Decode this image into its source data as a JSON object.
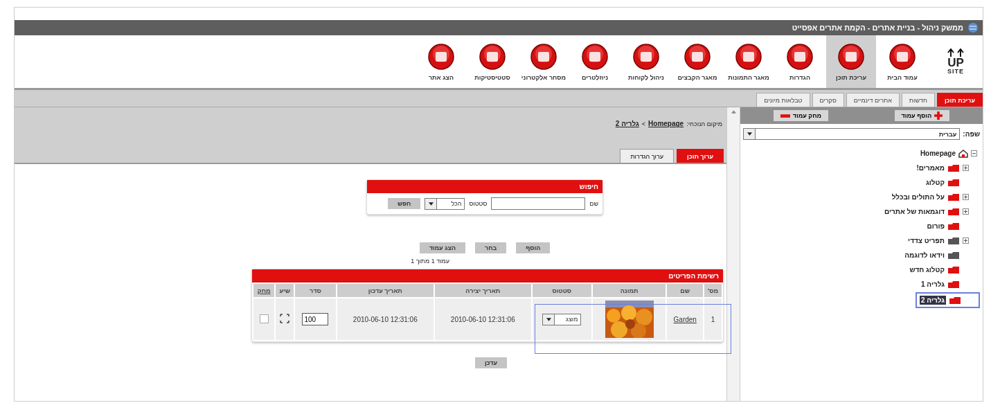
{
  "window": {
    "title": "ממשק ניהול - בניית אתרים - הקמת אתרים אפסייט"
  },
  "logo": {
    "top": "UP",
    "bottom": "SITE"
  },
  "toolbar": [
    {
      "label": "עמוד הבית",
      "selected": false
    },
    {
      "label": "עריכת תוכן",
      "selected": true
    },
    {
      "label": "הגדרות",
      "selected": false
    },
    {
      "label": "מאגר התמונות",
      "selected": false
    },
    {
      "label": "מאגר הקבצים",
      "selected": false
    },
    {
      "label": "ניהול לקוחות",
      "selected": false
    },
    {
      "label": "ניוזלטרים",
      "selected": false
    },
    {
      "label": "מסחר אלקטרוני",
      "selected": false
    },
    {
      "label": "סטטיסטיקות",
      "selected": false
    },
    {
      "label": "הצג אתר",
      "selected": false
    }
  ],
  "subtabs": [
    {
      "label": "עריכת תוכן",
      "selected": true
    },
    {
      "label": "חדשות",
      "selected": false
    },
    {
      "label": "אתרים דינמיים",
      "selected": false
    },
    {
      "label": "סקרים",
      "selected": false
    },
    {
      "label": "טבלאות מיונים",
      "selected": false
    }
  ],
  "sidebar": {
    "buttons": [
      {
        "label": "הוסף עמוד",
        "kind": "add"
      },
      {
        "label": "מחק עמוד",
        "kind": "delete"
      }
    ],
    "language_label": "שפה:",
    "language_value": "עברית",
    "tree": [
      {
        "label": "Homepage",
        "expanded": true,
        "selected": false,
        "children": [
          {
            "label": "מאמרים!",
            "hidden": false,
            "expandable": true,
            "selected": false
          },
          {
            "label": "קטלוג",
            "hidden": false,
            "expandable": false,
            "selected": false
          },
          {
            "label": "על התולים ובכלל",
            "hidden": false,
            "expandable": true,
            "selected": false
          },
          {
            "label": "דוגמאות של אתרים",
            "hidden": false,
            "expandable": true,
            "selected": false
          },
          {
            "label": "פורום",
            "hidden": false,
            "expandable": false,
            "selected": false
          },
          {
            "label": "תפריט צדדי",
            "hidden": true,
            "expandable": true,
            "selected": false
          },
          {
            "label": "וידאו לדוגמה",
            "hidden": true,
            "expandable": false,
            "selected": false
          },
          {
            "label": "קטלוג חדש",
            "hidden": false,
            "expandable": false,
            "selected": false
          },
          {
            "label": "גלריה 1",
            "hidden": false,
            "expandable": false,
            "selected": false
          },
          {
            "label": "גלריה 2",
            "hidden": false,
            "expandable": false,
            "selected": true
          }
        ]
      }
    ]
  },
  "breadcrumb": {
    "label": "מיקום הנוכחי:",
    "items": [
      "Homepage",
      "גלריה 2"
    ],
    "separator": ">"
  },
  "content_tabs": [
    {
      "label": "ערוך תוכן",
      "selected": true
    },
    {
      "label": "ערוך הגדרות",
      "selected": false
    }
  ],
  "search": {
    "title": "חיפוש",
    "name_label": "שם",
    "status_label": "סטטוס",
    "status_value": "הכל",
    "button": "חפש"
  },
  "actions": [
    "הוסף",
    "בחר",
    "הצג עמוד"
  ],
  "paging": "עמוד 1 מתוך 1",
  "table": {
    "title": "רשימת הפריטים",
    "columns": [
      "מס'",
      "שם",
      "תמונה",
      "סטטוס",
      "תאריך יצירה",
      "תאריך עדכון",
      "סדר",
      "שיע",
      "מחק"
    ],
    "rows": [
      {
        "number": "1",
        "name": "Garden",
        "status": "מוצג",
        "created": "12:31:06 2010-06-10",
        "updated": "12:31:06 2010-06-10",
        "order": "100",
        "checked": false
      }
    ]
  },
  "update_button": "עדכן"
}
